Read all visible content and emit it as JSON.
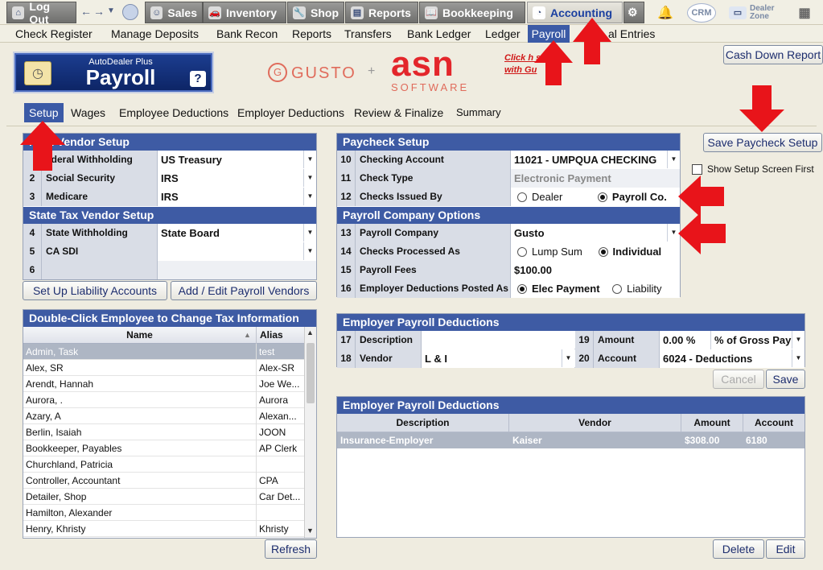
{
  "topnav": {
    "logout": "Log Out",
    "modules": [
      "Sales",
      "Inventory",
      "Shop",
      "Reports",
      "Bookkeeping",
      "Accounting"
    ],
    "crm": "CRM",
    "dealer_zone": "Dealer Zone"
  },
  "submenu": [
    "Check Register",
    "Manage Deposits",
    "Bank Recon",
    "Reports",
    "Transfers",
    "Bank Ledger",
    "Ledger",
    "Payroll",
    "al Entries"
  ],
  "cash_down_report": "Cash Down Report",
  "app_logo": {
    "line1": "AutoDealer Plus",
    "line2": "Payroll",
    "help": "?"
  },
  "partner": {
    "gusto": "GUSTO",
    "plus": "+",
    "asn": "asn",
    "software": "SOFTWARE",
    "link_line1": "Click h   sig",
    "link_line2": "with Gu"
  },
  "tabs": [
    "Setup",
    "Wages",
    "Employee Deductions",
    "Employer Deductions",
    "Review & Finalize",
    "Summary"
  ],
  "federal": {
    "header": "l Tax Vendor Setup",
    "rows": [
      {
        "num": "",
        "label": "ederal Withholding",
        "value": "US Treasury"
      },
      {
        "num": "2",
        "label": "Social Security",
        "value": "IRS"
      },
      {
        "num": "3",
        "label": "Medicare",
        "value": "IRS"
      }
    ]
  },
  "state": {
    "header": "State Tax Vendor Setup",
    "rows": [
      {
        "num": "4",
        "label": "State Withholding",
        "value": "State Board"
      },
      {
        "num": "5",
        "label": "CA SDI",
        "value": ""
      },
      {
        "num": "6",
        "label": "",
        "value": ""
      }
    ]
  },
  "liability_btn": "Set Up Liability Accounts",
  "vendors_btn": "Add / Edit Payroll Vendors",
  "employees": {
    "header": "Double-Click Employee to Change Tax Information",
    "col_name": "Name",
    "col_alias": "Alias",
    "rows": [
      {
        "name": "Admin, Task",
        "alias": "test"
      },
      {
        "name": "Alex, SR",
        "alias": "Alex-SR"
      },
      {
        "name": "Arendt, Hannah",
        "alias": "Joe We..."
      },
      {
        "name": "Aurora, .",
        "alias": "Aurora"
      },
      {
        "name": "Azary, A",
        "alias": "Alexan..."
      },
      {
        "name": "Berlin, Isaiah",
        "alias": "JOON"
      },
      {
        "name": "Bookkeeper, Payables",
        "alias": "AP Clerk"
      },
      {
        "name": "Churchland, Patricia",
        "alias": ""
      },
      {
        "name": "Controller, Accountant",
        "alias": "CPA"
      },
      {
        "name": "Detailer, Shop",
        "alias": "Car Det..."
      },
      {
        "name": "Hamilton, Alexander",
        "alias": ""
      },
      {
        "name": "Henry, Khristy",
        "alias": "Khristy"
      }
    ]
  },
  "refresh": "Refresh",
  "paycheck": {
    "header": "Paycheck Setup",
    "checking_num": "10",
    "checking_label": "Checking Account",
    "checking_value": "11021 - UMPQUA CHECKING",
    "type_num": "11",
    "type_label": "Check Type",
    "type_value": "Electronic Payment",
    "issued_num": "12",
    "issued_label": "Checks Issued By",
    "issued_opt1": "Dealer",
    "issued_opt2": "Payroll Co."
  },
  "company": {
    "header": "Payroll Company Options",
    "company_num": "13",
    "company_label": "Payroll Company",
    "company_value": "Gusto",
    "processed_num": "14",
    "processed_label": "Checks Processed As",
    "processed_opt1": "Lump Sum",
    "processed_opt2": "Individual",
    "fees_num": "15",
    "fees_label": "Payroll Fees",
    "fees_value": "$100.00",
    "posted_num": "16",
    "posted_label": "Employer Deductions Posted As",
    "posted_opt1": "Elec Payment",
    "posted_opt2": "Liability"
  },
  "save_paycheck": "Save Paycheck Setup",
  "show_setup_first": "Show Setup Screen First",
  "deduction_form": {
    "header": "Employer Payroll Deductions",
    "desc_num": "17",
    "desc_label": "Description",
    "desc_value": "",
    "vendor_num": "18",
    "vendor_label": "Vendor",
    "vendor_value": "L & I",
    "amount_num": "19",
    "amount_label": "Amount",
    "amount_value": "0.00 %",
    "amount_basis": "% of Gross Pay",
    "account_num": "20",
    "account_label": "Account",
    "account_value": "6024 - Deductions"
  },
  "cancel": "Cancel",
  "save": "Save",
  "deduction_table": {
    "header": "Employer Payroll Deductions",
    "columns": [
      "Description",
      "Vendor",
      "Amount",
      "Account"
    ],
    "rows": [
      {
        "description": "Insurance-Employer",
        "vendor": "Kaiser",
        "amount": "$308.00",
        "account": "6180"
      }
    ]
  },
  "delete": "Delete",
  "edit": "Edit",
  "colors": {
    "header_blue": "#3e5ba4",
    "arrow_red": "#e8141a",
    "selected_tab": "#3b5aa6"
  }
}
